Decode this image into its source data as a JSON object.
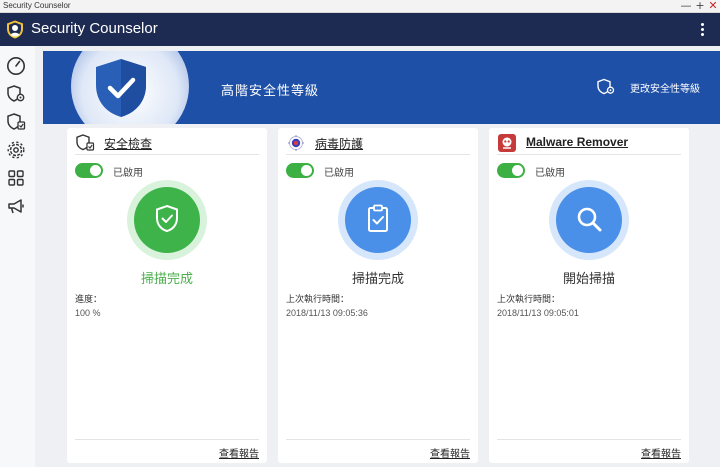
{
  "window": {
    "title": "Security Counselor",
    "controls": [
      "—",
      "+",
      "✕"
    ]
  },
  "app": {
    "title": "Security Counselor"
  },
  "sidebar": {
    "items": [
      {
        "name": "dashboard",
        "icon": "speedometer-icon"
      },
      {
        "name": "security-settings",
        "icon": "shield-gear-icon"
      },
      {
        "name": "security-check",
        "icon": "shield-check-icon"
      },
      {
        "name": "settings",
        "icon": "gear-icon"
      },
      {
        "name": "apps",
        "icon": "apps-grid-icon"
      },
      {
        "name": "announcements",
        "icon": "megaphone-icon"
      }
    ]
  },
  "banner": {
    "level": "高階安全性等級",
    "change_label": "更改安全性等級"
  },
  "cards": [
    {
      "title": "安全檢查",
      "icon": "shield-check-icon",
      "enabled_label": "已啟用",
      "status": "掃描完成",
      "label1": "進度：",
      "value1": "100 %",
      "report": "查看報告"
    },
    {
      "title": "病毒防護",
      "icon": "virus-icon",
      "enabled_label": "已啟用",
      "status": "掃描完成",
      "label1": "上次執行時間：",
      "value1": "2018/11/13 09:05:36",
      "report": "查看報告"
    },
    {
      "title": "Malware Remover",
      "icon": "malware-remover-icon",
      "enabled_label": "已啟用",
      "status": "開始掃描",
      "label1": "上次執行時間：",
      "value1": "2018/11/13 09:05:01",
      "report": "查看報告"
    }
  ],
  "colors": {
    "header": "#1d2a52",
    "banner": "#1f50a8",
    "toggle": "#3cb043",
    "success": "#4cae4c",
    "accent_blue": "#4a8fe8"
  }
}
